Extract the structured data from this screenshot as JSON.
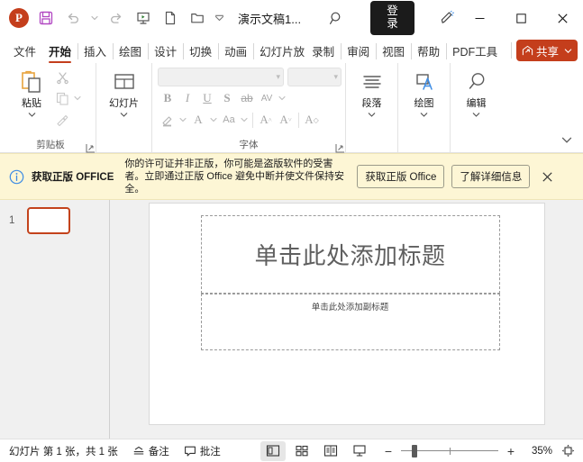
{
  "titlebar": {
    "app_icon": "powerpoint-logo",
    "logo_letter": "P",
    "doc_title": "演示文稿1...",
    "signin_label": "登录",
    "qat": [
      {
        "name": "save",
        "icon": "save-icon"
      },
      {
        "name": "undo",
        "icon": "undo-icon"
      },
      {
        "name": "redo",
        "icon": "redo-icon"
      },
      {
        "name": "start-slideshow",
        "icon": "slideshow-icon"
      },
      {
        "name": "new",
        "icon": "new-document-icon"
      },
      {
        "name": "open",
        "icon": "open-folder-icon"
      },
      {
        "name": "customize",
        "icon": "chevron-down-icon"
      }
    ],
    "window_controls": [
      "minimize",
      "maximize",
      "close"
    ]
  },
  "tabs": [
    {
      "label": "文件",
      "active": false
    },
    {
      "label": "开始",
      "active": true
    },
    {
      "label": "插入",
      "active": false
    },
    {
      "label": "绘图",
      "active": false
    },
    {
      "label": "设计",
      "active": false
    },
    {
      "label": "切换",
      "active": false
    },
    {
      "label": "动画",
      "active": false
    },
    {
      "label": "幻灯片放映",
      "active": false
    },
    {
      "label": "录制",
      "active": false
    },
    {
      "label": "审阅",
      "active": false
    },
    {
      "label": "视图",
      "active": false
    },
    {
      "label": "帮助",
      "active": false
    },
    {
      "label": "PDF工具集",
      "active": false
    }
  ],
  "share": {
    "label": "共享"
  },
  "ribbon": {
    "clipboard": {
      "group_label": "剪贴板",
      "paste_label": "粘贴",
      "cut_name": "cut-icon",
      "copy_name": "copy-icon",
      "format_painter_name": "format-painter-icon"
    },
    "slides": {
      "group_label": "",
      "new_slide_label": "幻灯片"
    },
    "font": {
      "group_label": "字体",
      "font_name_value": "",
      "font_size_value": "",
      "bold": "B",
      "italic": "I",
      "underline": "U",
      "shadow": "S",
      "strikethrough": "ab",
      "char_spacing": "AV",
      "change_case": "Aa",
      "increase_size": "A",
      "decrease_size": "A",
      "clear_format": "A"
    },
    "paragraph": {
      "label": "段落"
    },
    "drawing": {
      "label": "绘图"
    },
    "editing": {
      "label": "编辑"
    }
  },
  "message_bar": {
    "heading": "获取正版 OFFICE",
    "body": "你的许可证并非正版，你可能是盗版软件的受害者。立即通过正版 Office 避免中断并使文件保持安全。",
    "primary_button": "获取正版 Office",
    "secondary_button": "了解详细信息",
    "close_label": "×",
    "bg_color": "#fdf6d5"
  },
  "thumbnails": [
    {
      "number": "1",
      "selected": true
    }
  ],
  "slide": {
    "title_placeholder": "单击此处添加标题",
    "subtitle_placeholder": "单击此处添加副标题"
  },
  "statusbar": {
    "slide_count_text": "幻灯片 第 1 张，共 1 张",
    "notes_label": "备注",
    "comments_label": "批注",
    "views": [
      {
        "name": "normal-view",
        "active": true
      },
      {
        "name": "slide-sorter-view",
        "active": false
      },
      {
        "name": "reading-view",
        "active": false
      },
      {
        "name": "slideshow-view",
        "active": false
      }
    ],
    "zoom_out": "−",
    "zoom_in": "+",
    "zoom_value": "35%"
  },
  "colors": {
    "accent": "#c43e1c",
    "save_purple": "#b146c2",
    "message_bg": "#fdf6d5",
    "selected_thumb_border": "#c3431c"
  }
}
